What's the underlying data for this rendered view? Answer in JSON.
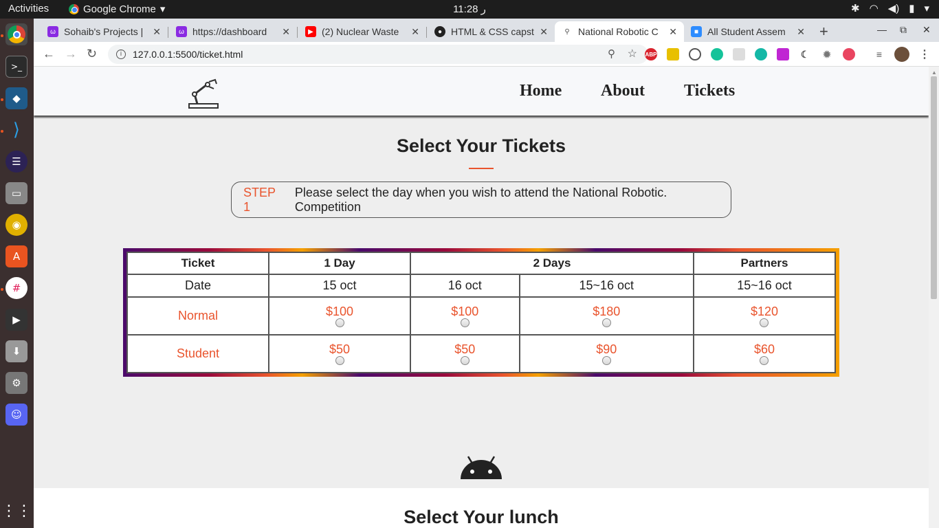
{
  "os": {
    "activities": "Activities",
    "app_name": "Google Chrome",
    "clock": "11:28 ر"
  },
  "browser": {
    "tabs": [
      {
        "title": "Sohaib's Projects |",
        "fav_color": "#8a2be2"
      },
      {
        "title": "https://dashboard",
        "fav_color": "#8a2be2"
      },
      {
        "title": "(2) Nuclear Waste",
        "fav_color": "#ff0000"
      },
      {
        "title": "HTML & CSS capst",
        "fav_color": "#222222"
      },
      {
        "title": "National Robotic C",
        "fav_color": "#ffffff"
      },
      {
        "title": "All Student Assem",
        "fav_color": "#2d8cff"
      }
    ],
    "url": "127.0.0.1:5500/ticket.html",
    "ext_abp": "ABP"
  },
  "site": {
    "nav": [
      "Home",
      "About",
      "Tickets"
    ],
    "ticket_title": "Select Your Tickets",
    "step_label": "STEP 1",
    "step_text": "Please select the day when you wish to attend the National Robotic. Competition",
    "table": {
      "headers": [
        "Ticket",
        "1 Day",
        "2 Days",
        "Partners"
      ],
      "date_label": "Date",
      "dates": [
        "15 oct",
        "16 oct",
        "15~16 oct",
        "15~16 oct"
      ],
      "rows": [
        {
          "label": "Normal",
          "prices": [
            "$100",
            "$100",
            "$180",
            "$120"
          ]
        },
        {
          "label": "Student",
          "prices": [
            "$50",
            "$50",
            "$90",
            "$60"
          ]
        }
      ]
    },
    "lunch_title": "Select Your lunch"
  }
}
